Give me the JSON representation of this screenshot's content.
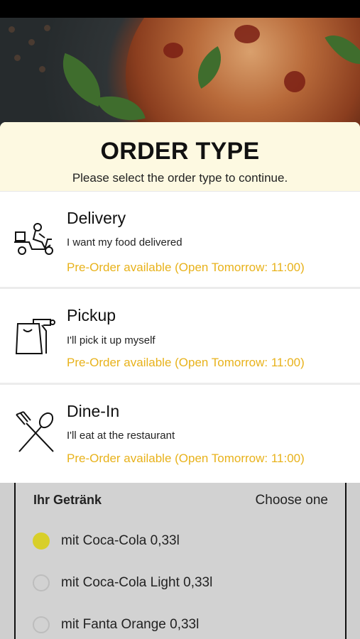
{
  "modal": {
    "title": "ORDER TYPE",
    "subtitle": "Please select the order type to continue.",
    "options": [
      {
        "title": "Delivery",
        "description": "I want my food delivered",
        "preorder": "Pre-Order available (Open Tomorrow: 11:00)",
        "icon": "scooter-delivery-icon"
      },
      {
        "title": "Pickup",
        "description": "I'll pick it up myself",
        "preorder": "Pre-Order available (Open Tomorrow: 11:00)",
        "icon": "takeaway-bag-icon"
      },
      {
        "title": "Dine-In",
        "description": "I'll eat at the restaurant",
        "preorder": "Pre-Order available (Open Tomorrow: 11:00)",
        "icon": "fork-spoon-icon"
      }
    ]
  },
  "background": {
    "group_label": "Ihr Getränk",
    "choose_label": "Choose one",
    "drink_options": [
      {
        "label": "mit Coca-Cola 0,33l",
        "selected": true
      },
      {
        "label": "mit Coca-Cola Light 0,33l",
        "selected": false
      },
      {
        "label": "mit Fanta Orange 0,33l",
        "selected": false
      }
    ]
  },
  "colors": {
    "accent": "#e8b21b",
    "header_bg": "#fdf9e1",
    "radio_selected": "#d8cf2a"
  }
}
